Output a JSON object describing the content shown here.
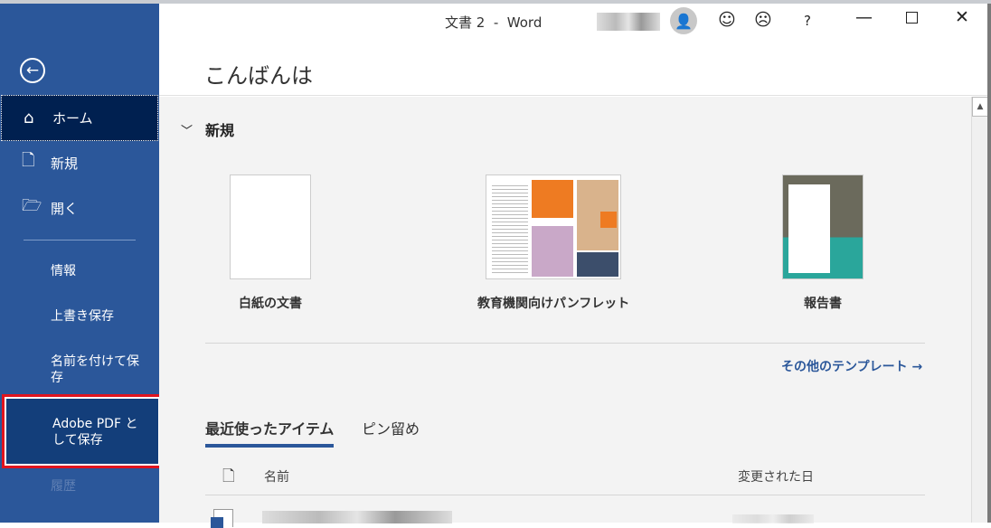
{
  "window": {
    "title": "文書 2  -  Word",
    "controls": [
      "minimize",
      "maximize",
      "close"
    ]
  },
  "header": {
    "greeting": "こんばんは",
    "icons": [
      "account-avatar",
      "smile-feedback",
      "frown-feedback",
      "help"
    ],
    "help_label": "?"
  },
  "sidebar": {
    "back_icon": "arrow-left-circle",
    "items": [
      {
        "label": "ホーム",
        "icon": "home",
        "selected": true
      },
      {
        "label": "新規",
        "icon": "document"
      },
      {
        "label": "開く",
        "icon": "folder-open"
      }
    ],
    "sub_items": [
      {
        "label": "情報"
      },
      {
        "label": "上書き保存"
      },
      {
        "label": "名前を付けて保存"
      },
      {
        "label": "Adobe PDF として保存",
        "highlighted": true
      },
      {
        "label": "履歴",
        "disabled": true
      }
    ]
  },
  "new_section": {
    "heading": "新規",
    "templates": [
      {
        "label": "白紙の文書"
      },
      {
        "label": "教育機関向けパンフレット"
      },
      {
        "label": "報告書"
      }
    ],
    "more_templates": "その他のテンプレート →"
  },
  "recent": {
    "tabs": [
      {
        "label": "最近使ったアイテム",
        "active": true
      },
      {
        "label": "ピン留め"
      }
    ],
    "columns": [
      "名前",
      "変更された日"
    ]
  },
  "colors": {
    "sidebar": "#2b579a",
    "selected": "#002050",
    "highlight_border": "#e0141e"
  }
}
